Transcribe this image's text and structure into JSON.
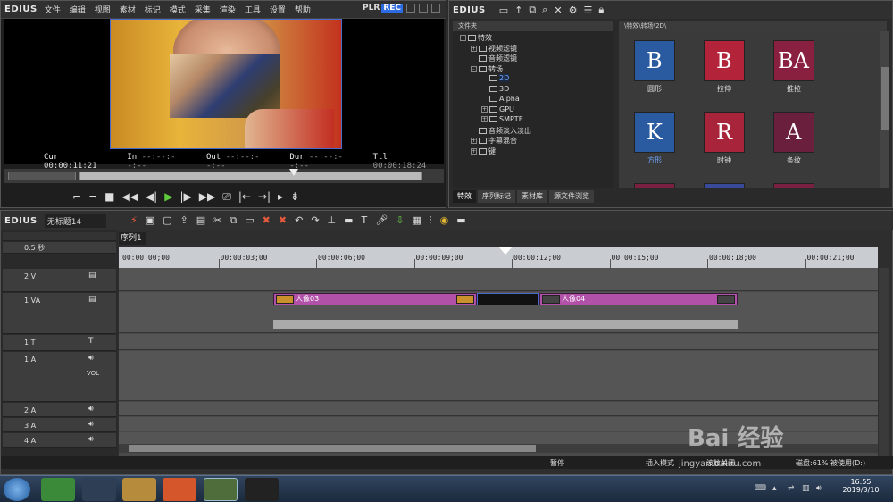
{
  "player": {
    "logo": "EDIUS",
    "menu": [
      "文件",
      "编辑",
      "视图",
      "素材",
      "标记",
      "模式",
      "采集",
      "渲染",
      "工具",
      "设置",
      "帮助"
    ],
    "plr": "PLR",
    "rec": "REC",
    "timecodes": {
      "cur_label": "Cur",
      "cur": "00:00:11:21",
      "in_label": "In",
      "in": "--:--:--:--",
      "out_label": "Out",
      "out": "--:--:--:--",
      "dur_label": "Dur",
      "dur": "--:--:--:--",
      "ttl_label": "Ttl",
      "ttl": "00:00:18:24"
    }
  },
  "effects": {
    "logo": "EDIUS",
    "tree_header": "文件夹",
    "path": "\\特效\\转场\\2D\\",
    "tree": [
      {
        "label": "特效",
        "expand": "-",
        "depth": 0
      },
      {
        "label": "视频滤镜",
        "expand": "+",
        "depth": 1
      },
      {
        "label": "音频滤镜",
        "expand": "",
        "depth": 1
      },
      {
        "label": "转场",
        "expand": "-",
        "depth": 1
      },
      {
        "label": "2D",
        "expand": "",
        "depth": 2,
        "selected": true
      },
      {
        "label": "3D",
        "expand": "",
        "depth": 2
      },
      {
        "label": "Alpha",
        "expand": "",
        "depth": 2
      },
      {
        "label": "GPU",
        "expand": "+",
        "depth": 2
      },
      {
        "label": "SMPTE",
        "expand": "+",
        "depth": 2
      },
      {
        "label": "音频淡入淡出",
        "expand": "",
        "depth": 1
      },
      {
        "label": "字幕混合",
        "expand": "+",
        "depth": 1
      },
      {
        "label": "键",
        "expand": "+",
        "depth": 1
      }
    ],
    "items": [
      {
        "name": "圆形",
        "letter": "B",
        "bg": "#2a5aa0",
        "selected": false
      },
      {
        "name": "拉伸",
        "letter": "B",
        "bg": "#b3243a",
        "selected": false
      },
      {
        "name": "推拉",
        "letter": "BA",
        "bg": "#8a2040",
        "selected": false
      },
      {
        "name": "方形",
        "letter": "K",
        "bg": "#2a5aa0",
        "selected": true
      },
      {
        "name": "时钟",
        "letter": "R",
        "bg": "#a8243a",
        "selected": false
      },
      {
        "name": "条纹",
        "letter": "A",
        "bg": "#6a1f3c",
        "selected": false
      }
    ],
    "tabs": [
      "特效",
      "序列标记",
      "素材库",
      "源文件浏览"
    ]
  },
  "timeline": {
    "logo": "EDIUS",
    "project": "无标题14",
    "sequence_tab": "序列1",
    "zoom": "0.5 秒",
    "ruler_labels": [
      "00:00:00;00",
      "00:00:03;00",
      "00:00:06;00",
      "00:00:09;00",
      "00:00:12;00",
      "00:00:15;00",
      "00:00:18;00",
      "00:00:21;00"
    ],
    "tracks": [
      {
        "name": "2 V"
      },
      {
        "name": "1 VA"
      },
      {
        "name": "1 T"
      },
      {
        "name": "1 A",
        "vol": "VOL"
      },
      {
        "name": "2 A"
      },
      {
        "name": "3 A"
      },
      {
        "name": "4 A"
      }
    ],
    "clips": [
      {
        "label": "人像03"
      },
      {
        "label": "人像04"
      }
    ],
    "status": {
      "pause": "暂停",
      "insert": "插入模式",
      "ripple": "波纹关闭",
      "disk": "磁盘:61% 被使用(D:)"
    }
  },
  "taskbar": {
    "time": "16:55",
    "date": "2019/3/10"
  },
  "watermark": {
    "brand": "Bai 经验",
    "url": "jingyan.baidu.com"
  }
}
